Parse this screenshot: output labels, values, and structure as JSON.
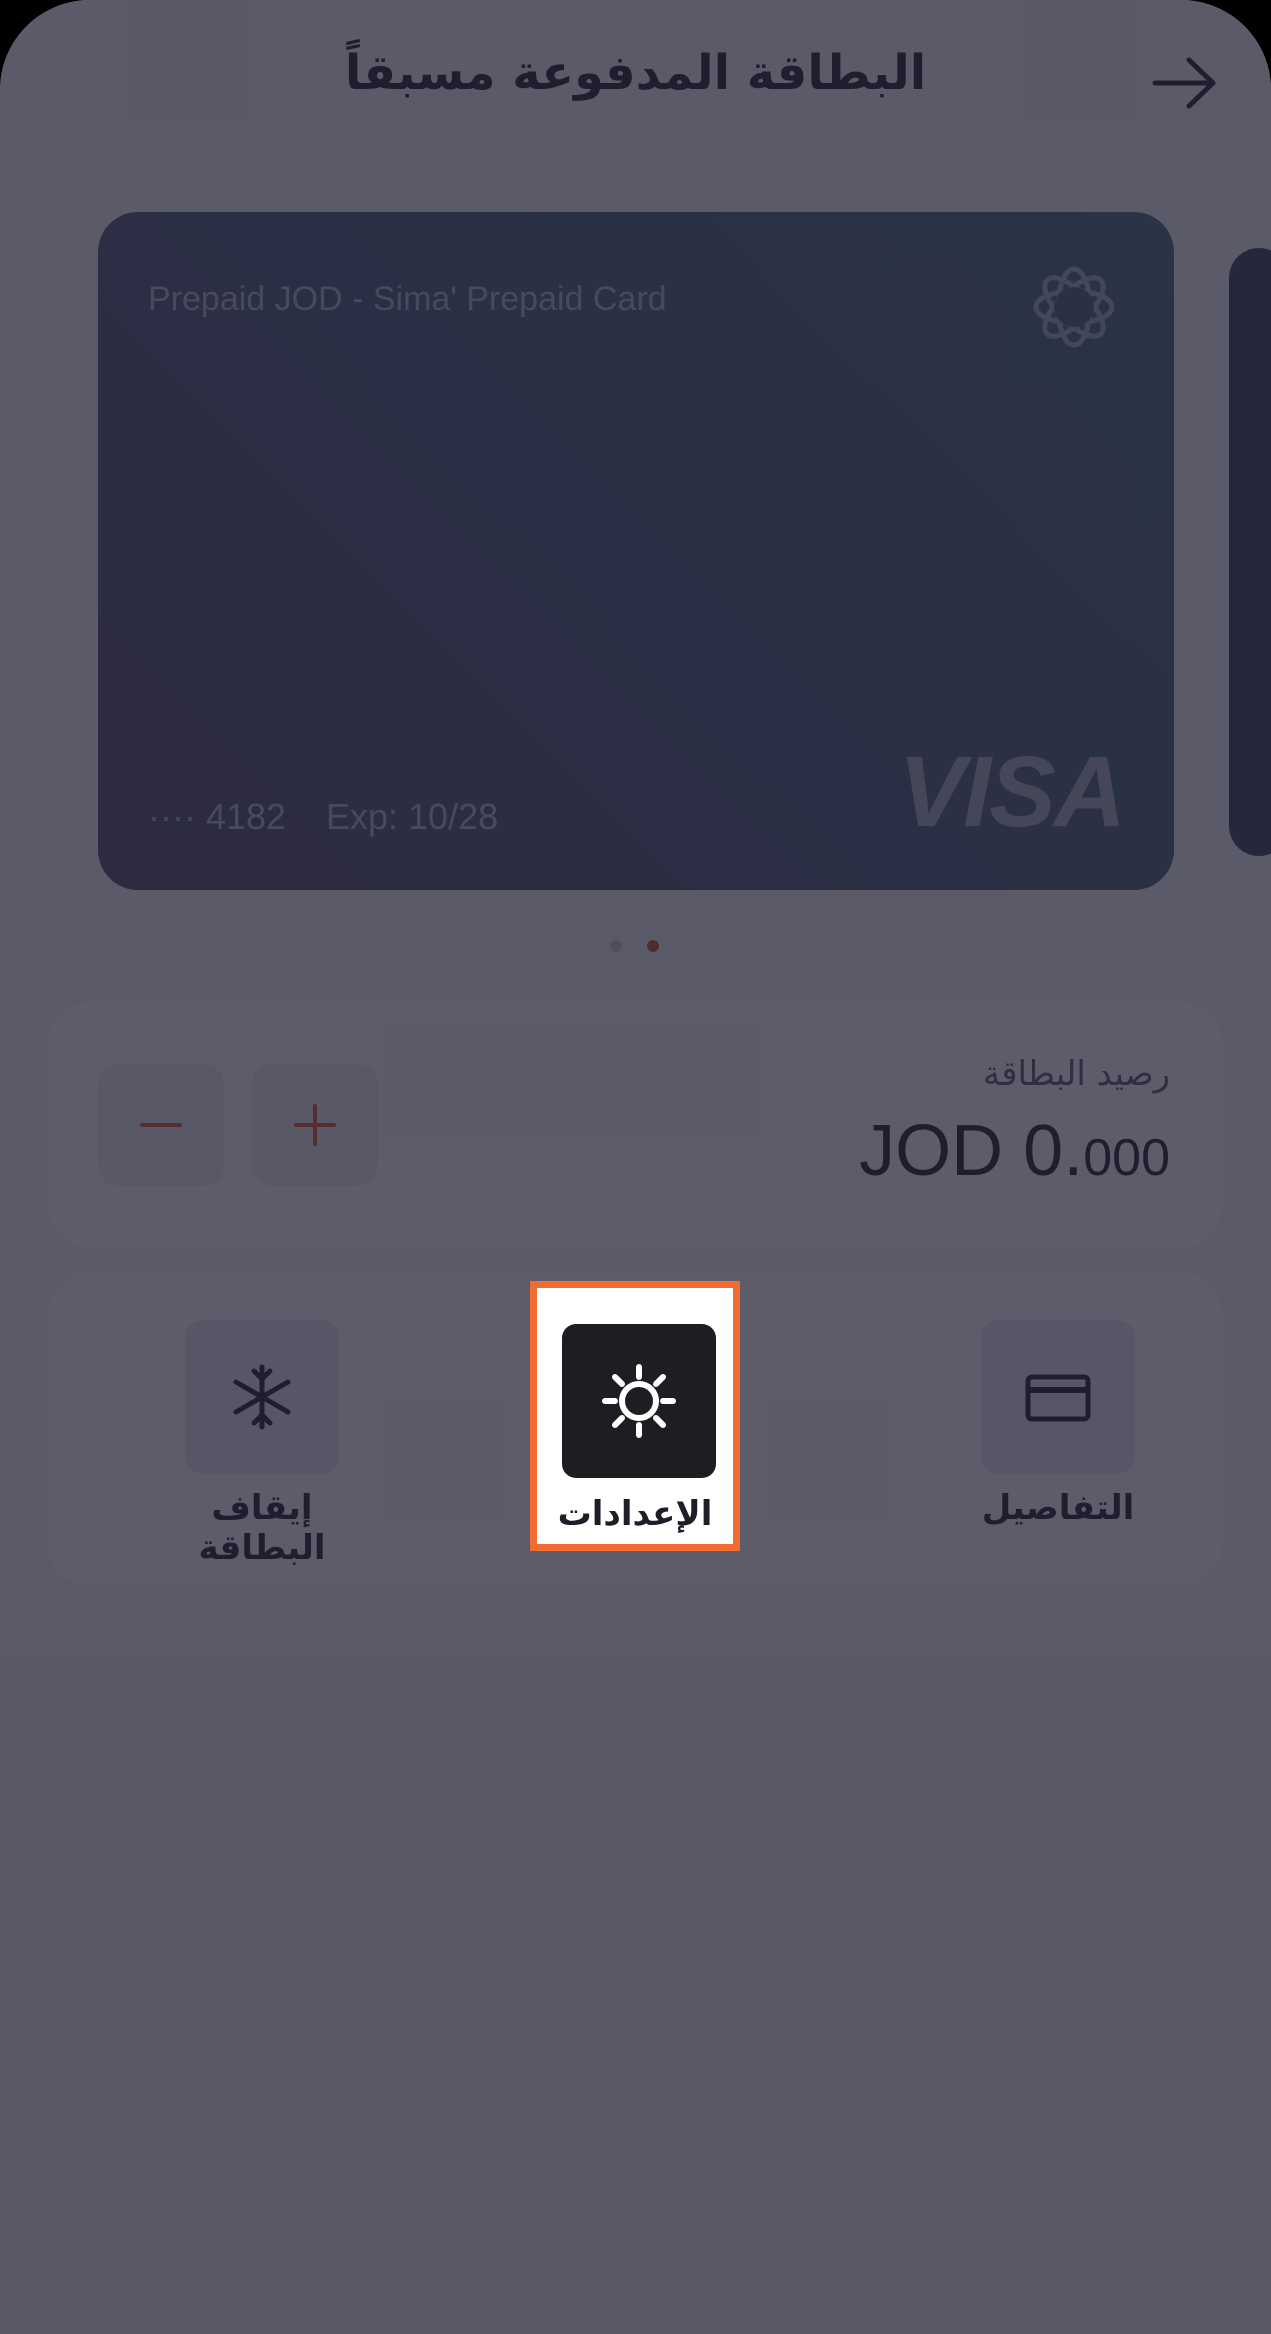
{
  "header": {
    "title": "البطاقة المدفوعة مسبقاً",
    "back_icon": "arrow-right-icon"
  },
  "card": {
    "name": "Prepaid JOD - Sima' Prepaid Card",
    "masked_number": "···· 4182",
    "expiry": "Exp: 10/28",
    "network": "VISA",
    "logo_icon": "sima-flower-logo"
  },
  "pager": {
    "count": 2,
    "active_index": 1,
    "active_color": "#C9532C"
  },
  "balance": {
    "label": "رصيد البطاقة",
    "amount_main": "JOD 0.",
    "amount_decimals": "000",
    "minus_icon": "minus-icon",
    "plus_icon": "plus-icon"
  },
  "actions": {
    "freeze": {
      "label": "إيقاف البطاقة",
      "icon": "snowflake-icon"
    },
    "settings": {
      "label": "الإعدادات",
      "icon": "gear-icon"
    },
    "details": {
      "label": "التفاصيل",
      "icon": "card-icon"
    }
  },
  "highlight": {
    "target": "settings",
    "border_color": "#F26B30"
  }
}
